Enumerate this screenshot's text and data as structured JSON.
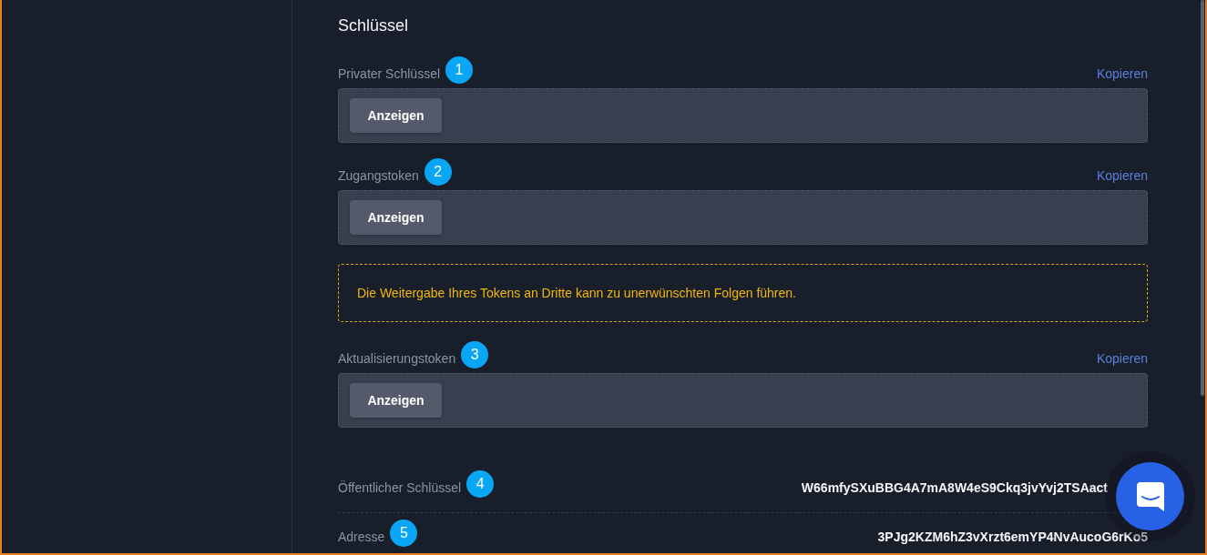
{
  "section": {
    "title": "Schlüssel"
  },
  "fields": [
    {
      "kind": "secret",
      "label": "Privater Schlüssel",
      "marker": "1",
      "copy_link": "Kopieren",
      "reveal_button": "Anzeigen"
    },
    {
      "kind": "secret",
      "label": "Zugangstoken",
      "marker": "2",
      "copy_link": "Kopieren",
      "reveal_button": "Anzeigen"
    },
    {
      "kind": "warning",
      "text": "Die Weitergabe Ihres Tokens an Dritte kann zu unerwünschten Folgen führen."
    },
    {
      "kind": "secret",
      "label": "Aktualisierungstoken",
      "marker": "3",
      "copy_link": "Kopieren",
      "reveal_button": "Anzeigen"
    }
  ],
  "details": [
    {
      "label": "Öffentlicher Schlüssel",
      "marker": "4",
      "value": "W66mfySXuBBG4A7mA8W4eS9Ckq3jvYvj2TSAact"
    },
    {
      "label": "Adresse",
      "marker": "5",
      "value": "3PJg2KZM6hZ3vXrzt6emYP4NvAucoG6rKo5"
    }
  ]
}
